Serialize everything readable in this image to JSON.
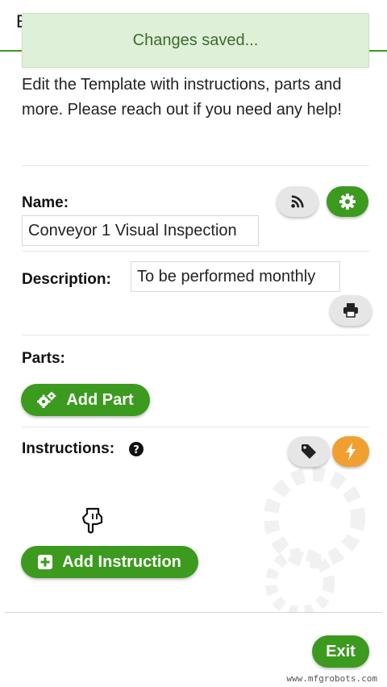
{
  "header": {
    "title_visible_fragment": "E"
  },
  "toast": {
    "message": "Changes saved..."
  },
  "intro": {
    "text": "Edit the Template with instructions, parts and more. Please reach out if you need any help!"
  },
  "name": {
    "label": "Name:",
    "value": "Conveyor 1 Visual Inspection"
  },
  "description": {
    "label": "Description:",
    "value": "To be performed monthly"
  },
  "parts": {
    "label": "Parts:",
    "add_button": "Add Part"
  },
  "instructions": {
    "label": "Instructions:",
    "add_button": "Add Instruction"
  },
  "exit_button": "Exit",
  "watermark": "www.mfgrobots.com",
  "icons": {
    "rss": "rss-icon",
    "settings": "gear-icon",
    "print": "print-icon",
    "help": "question-circle-icon",
    "tag": "tag-icon",
    "bolt": "bolt-icon",
    "cogs": "cogs-icon",
    "plus": "plus-square-icon",
    "hand": "pointing-hand-icon"
  },
  "colors": {
    "brand_green": "#3c9a1f",
    "toast_bg": "#dff0d8",
    "toast_text": "#3c6b2b",
    "accent_orange": "#f0a030"
  }
}
